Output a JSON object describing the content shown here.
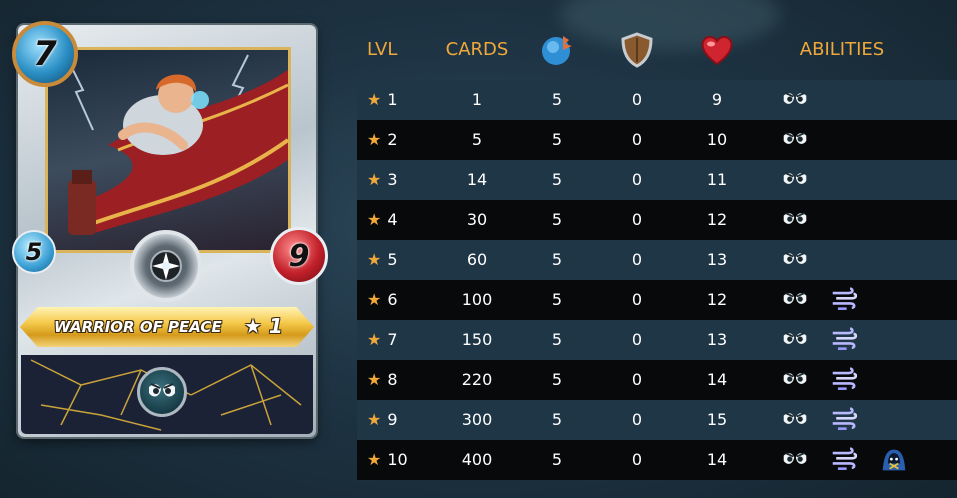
{
  "card": {
    "name": "WARRIOR OF PEACE",
    "level_label": "★ 1",
    "mana": "7",
    "speed": "5",
    "health": "9"
  },
  "table": {
    "headers": {
      "lvl": "LVL",
      "cards": "CARDS",
      "abilities": "ABILITIES"
    },
    "header_icons": [
      "speed-icon",
      "armor-icon",
      "health-icon"
    ],
    "rows": [
      {
        "lvl": "1",
        "cards": "1",
        "speed": "5",
        "armor": "0",
        "health": "9",
        "abilities": [
          "true-strike"
        ]
      },
      {
        "lvl": "2",
        "cards": "5",
        "speed": "5",
        "armor": "0",
        "health": "10",
        "abilities": [
          "true-strike"
        ]
      },
      {
        "lvl": "3",
        "cards": "14",
        "speed": "5",
        "armor": "0",
        "health": "11",
        "abilities": [
          "true-strike"
        ]
      },
      {
        "lvl": "4",
        "cards": "30",
        "speed": "5",
        "armor": "0",
        "health": "12",
        "abilities": [
          "true-strike"
        ]
      },
      {
        "lvl": "5",
        "cards": "60",
        "speed": "5",
        "armor": "0",
        "health": "13",
        "abilities": [
          "true-strike"
        ]
      },
      {
        "lvl": "6",
        "cards": "100",
        "speed": "5",
        "armor": "0",
        "health": "12",
        "abilities": [
          "true-strike",
          "dodge"
        ]
      },
      {
        "lvl": "7",
        "cards": "150",
        "speed": "5",
        "armor": "0",
        "health": "13",
        "abilities": [
          "true-strike",
          "dodge"
        ]
      },
      {
        "lvl": "8",
        "cards": "220",
        "speed": "5",
        "armor": "0",
        "health": "14",
        "abilities": [
          "true-strike",
          "dodge"
        ]
      },
      {
        "lvl": "9",
        "cards": "300",
        "speed": "5",
        "armor": "0",
        "health": "15",
        "abilities": [
          "true-strike",
          "dodge"
        ]
      },
      {
        "lvl": "10",
        "cards": "400",
        "speed": "5",
        "armor": "0",
        "health": "14",
        "abilities": [
          "true-strike",
          "dodge",
          "cloak"
        ]
      }
    ]
  },
  "colors": {
    "header_text": "#f0a83a",
    "row_odd": "#1f3646",
    "row_even": "#07090b",
    "text": "#ffffff"
  }
}
